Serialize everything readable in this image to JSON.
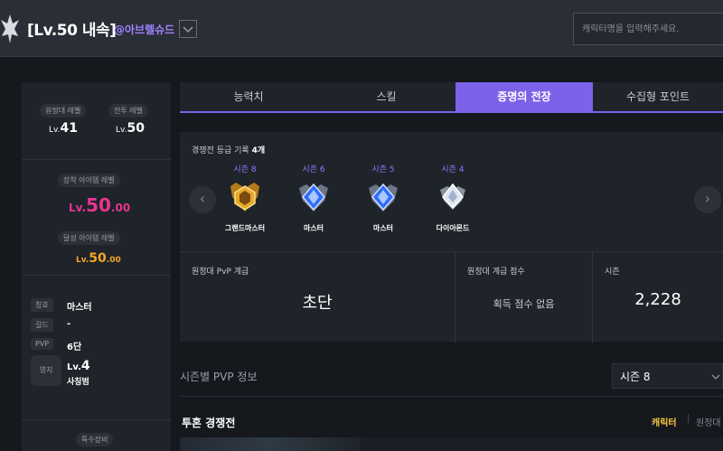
{
  "header": {
    "title": "[Lv.50 내속]",
    "server": "@아브렐슈드",
    "search_placeholder": "캐릭터명을 입력해주세요."
  },
  "profile": {
    "expedition_level_label": "원정대 레벨",
    "expedition_level_prefix": "Lv.",
    "expedition_level": "41",
    "combat_level_label": "전투 레벨",
    "combat_level_prefix": "Lv.",
    "combat_level": "50",
    "equipped_item_level_label": "장착 아이템 레벨",
    "equipped_item_level_prefix": "Lv.",
    "equipped_item_level_int": "50",
    "equipped_item_level_dec": ".00",
    "achieved_item_level_label": "달성 아이템 레벨",
    "achieved_item_level_prefix": "Lv.",
    "achieved_item_level_int": "50",
    "achieved_item_level_dec": ".00",
    "rows": [
      {
        "label": "칭호",
        "value": "마스터"
      },
      {
        "label": "길드",
        "value": "-"
      },
      {
        "label": "PVP",
        "value": "6단"
      }
    ],
    "estate_label": "영지",
    "estate_level_prefix": "Lv.",
    "estate_level": "4",
    "estate_name": "사칭범",
    "special_equipment_label": "특수장비"
  },
  "tabs": [
    {
      "label": "능력치",
      "active": false
    },
    {
      "label": "스킬",
      "active": false
    },
    {
      "label": "증명의 전장",
      "active": true
    },
    {
      "label": "수집형 포인트",
      "active": false
    }
  ],
  "ranking": {
    "title": "경쟁전 등급 기록",
    "count": "4개",
    "badges": [
      {
        "season": "시즌 8",
        "name": "그랜드마스터",
        "tier": "gold"
      },
      {
        "season": "시즌 6",
        "name": "마스터",
        "tier": "blue"
      },
      {
        "season": "시즌 5",
        "name": "마스터",
        "tier": "blue"
      },
      {
        "season": "시즌 4",
        "name": "다이아몬드",
        "tier": "silver"
      }
    ],
    "prev_arrow": "‹",
    "next_arrow": "›"
  },
  "stats": {
    "pvp_grade_label": "원정대 PvP 계급",
    "pvp_grade_value": "초단",
    "pvp_score_label": "원정대 계급 점수",
    "pvp_score_value": "획득 점수 없음",
    "season_label": "시즌",
    "season_value": "2,228"
  },
  "season_section": {
    "title": "시즌별 PVP 정보",
    "selected_season": "시즌 8"
  },
  "duel": {
    "title": "투혼 경쟁전",
    "filter_character": "캐릭터",
    "separator": "|",
    "filter_expedition": "원정대"
  },
  "colors": {
    "accent": "#7b62e8",
    "item_level": "#e8358f",
    "achieved_level": "#f5a623"
  }
}
